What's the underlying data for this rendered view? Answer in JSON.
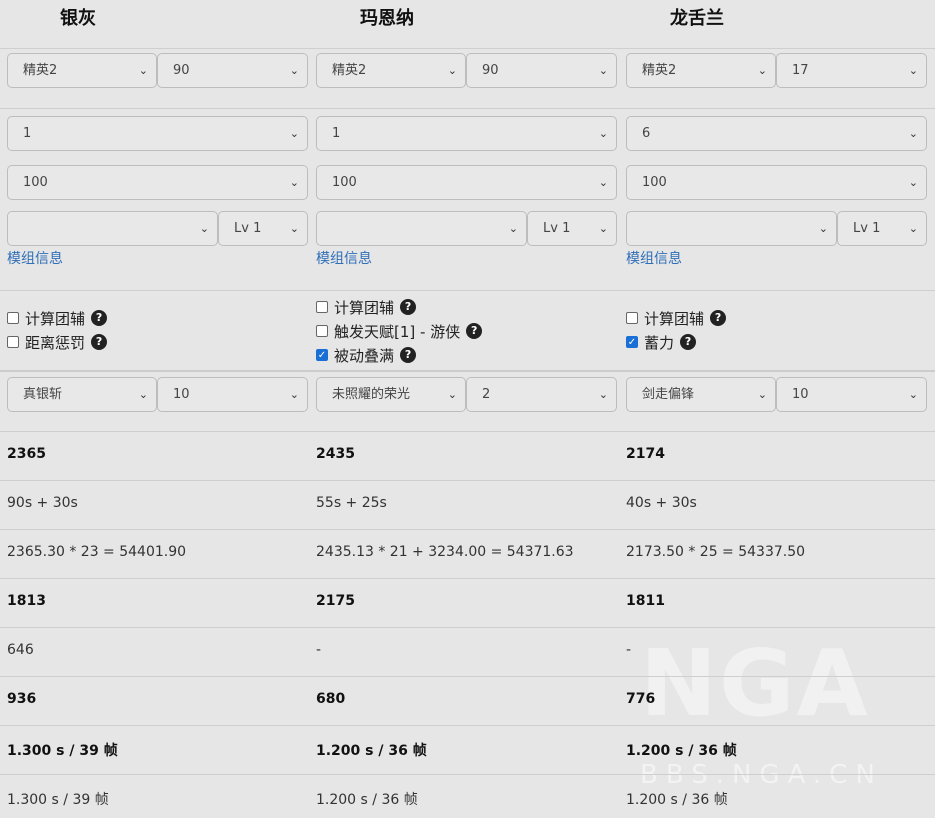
{
  "watermark": {
    "logo": "NGA",
    "site": "BBS.NGA.CN"
  },
  "columns": [
    {
      "name": "银灰",
      "elite": "精英2",
      "level": "90",
      "potential": "1",
      "trust": "100",
      "module": "",
      "module_level": "Lv 1",
      "module_info": "模组信息",
      "options": [
        {
          "label": "计算团辅",
          "checked": false
        },
        {
          "label": "距离惩罚",
          "checked": false
        }
      ],
      "skill": "真银斩",
      "skill_level": "10",
      "rows": [
        "2365",
        "90s + 30s",
        "2365.30 * 23 = 54401.90",
        "1813",
        "646",
        "936",
        "1.300 s / 39 帧",
        "1.300 s / 39 帧"
      ]
    },
    {
      "name": "玛恩纳",
      "elite": "精英2",
      "level": "90",
      "potential": "1",
      "trust": "100",
      "module": "",
      "module_level": "Lv 1",
      "module_info": "模组信息",
      "options": [
        {
          "label": "计算团辅",
          "checked": false
        },
        {
          "label": "触发天赋[1] - 游侠",
          "checked": false
        },
        {
          "label": "被动叠满",
          "checked": true
        }
      ],
      "skill": "未照耀的荣光",
      "skill_level": "2",
      "rows": [
        "2435",
        "55s + 25s",
        "2435.13 * 21 + 3234.00 = 54371.63",
        "2175",
        "-",
        "680",
        "1.200 s / 36 帧",
        "1.200 s / 36 帧"
      ]
    },
    {
      "name": "龙舌兰",
      "elite": "精英2",
      "level": "17",
      "potential": "6",
      "trust": "100",
      "module": "",
      "module_level": "Lv 1",
      "module_info": "模组信息",
      "options": [
        {
          "label": "计算团辅",
          "checked": false
        },
        {
          "label": "蓄力",
          "checked": true
        }
      ],
      "skill": "剑走偏锋",
      "skill_level": "10",
      "rows": [
        "2174",
        "40s + 30s",
        "2173.50 * 25 = 54337.50",
        "1811",
        "-",
        "776",
        "1.200 s / 36 帧",
        "1.200 s / 36 帧"
      ]
    }
  ]
}
